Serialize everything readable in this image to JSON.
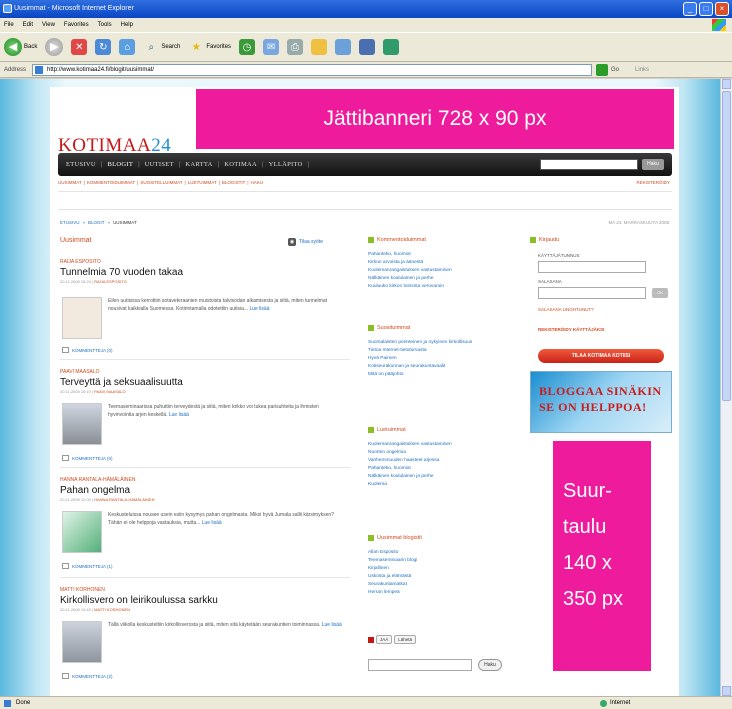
{
  "window": {
    "title": "Uusimmat - Microsoft Internet Explorer",
    "controls": [
      "_",
      "□",
      "×"
    ]
  },
  "menu": [
    "File",
    "Edit",
    "View",
    "Favorites",
    "Tools",
    "Help"
  ],
  "toolbar": {
    "back_label": "Back",
    "search_label": "Search",
    "favorites_label": "Favorites"
  },
  "address": {
    "label": "Address",
    "url": "http://www.kotimaa24.fi/blogit/uusimmat/",
    "go_label": "Go",
    "links_label": "Links"
  },
  "site": {
    "logo_main": "KOTIMAA",
    "logo_num": "24",
    "top_banner": "Jättibanneri 728 x 90 px",
    "nav": [
      "ETUSIVU",
      "BLOGIT",
      "UUTISET",
      "KARTTA",
      "KOTIMAA",
      "YLLÄPITO"
    ],
    "nav_search_btn": "Haku",
    "subnav": [
      "UUSIMMAT",
      "KOMMENTOIDUIMMAT",
      "SUOSITELLUIMMAT",
      "LUETUIMMAT",
      "BLOGISTIT",
      "HAKU"
    ],
    "subnav_register": "REKISTERÖIDY",
    "breadcrumb": [
      "ETUSIVU",
      "BLOGIT",
      "UUSIMMAT"
    ],
    "date": "MA 24. MARRASKUUTA 2008"
  },
  "left": {
    "section_title": "Uusimmat",
    "rss_label": "Tilaa syöte",
    "posts": [
      {
        "blogger": "RAIJA ESPOSITO",
        "title": "Tunnelmia 70 vuoden takaa",
        "meta": "20.11.2008 15:20",
        "author": "RAIJA ESPOSITO",
        "excerpt": "Eilen uutisissa kerrottiin sotaveteraanien muistoista talvisodan alkamisesta ja siitä, miten tunnelmat nousivat kaikkialla Suomessa. Kotirintamalla odotettiin uutisia...",
        "more": "Lue lisää",
        "comments": "KOMMENTTEJA (0)"
      },
      {
        "blogger": "PAAVI MAASALO",
        "title": "Terveyttä ja seksuaalisuutta",
        "meta": "20.11.2008 15:10",
        "author": "PAAVI MAASALO",
        "excerpt": "Teemaseminaarissa puhuttiin terveydestä ja siitä, miten kirkko voi tukea parisuhteita ja ihmisten hyvinvointia arjen keskellä.",
        "more": "Lue lisää",
        "comments": "KOMMENTTEJA (0)"
      },
      {
        "blogger": "HANNA RANTALA-HÄMÄLÄINEN",
        "title": "Pahan ongelma",
        "meta": "20.11.2008 12:00",
        "author": "HANNA RANTALA-HÄMÄLÄINEN",
        "excerpt": "Keskusteluissa nousee usein esiin kysymys pahan ongelmasta. Miksi hyvä Jumala sallii kärsimyksen? Tähän ei ole helppoja vastauksia, mutta...",
        "more": "Lue lisää",
        "comments": "KOMMENTTEJA (1)"
      },
      {
        "blogger": "MATTI KORHONEN",
        "title": "Kirkollisvero on leirikoulussa sarkku",
        "meta": "20.11.2008 10:45",
        "author": "MATTI KORHONEN",
        "excerpt": "Tällä viikolla keskusteltiin kirkollisverosta ja siitä, miten sitä käytetään seurakuntien toiminnassa.",
        "more": "Lue lisää",
        "comments": "KOMMENTTEJA (2)"
      }
    ]
  },
  "mid": {
    "blocks": [
      {
        "title": "Kommentoiduimmat",
        "items": [
          "Pahanteko, huomiot",
          "Kirkon arvoista ja äänestä",
          "Kuolemanrangaistuksen vastustaminen",
          "Nälkäinen koululainen ja perhe",
          "Kuuluuko kirkon toiminta verovaroin"
        ]
      },
      {
        "title": "Suosituimmat",
        "items": [
          "Suomalaisten perinteinen ja nykyinen kirkollisuus",
          "Tietoa Internet-tietoturvasta",
          "Hyvä Paimen",
          "Kotiseurakunnan ja seurakuntavaalit",
          "Mitä on pääjohto"
        ]
      },
      {
        "title": "Luetuimmat",
        "items": [
          "Kuolemanrangaistuksen vastustaminen",
          "Nuorten ongelmia",
          "Vanhemmuuden haasteet arjessa",
          "Pahanteko, huomiot",
          "Nälkäinen koululainen ja perhe",
          "Kuolema"
        ]
      },
      {
        "title": "Uusimmat blogistit",
        "items": [
          "Allan Esposito",
          "Teemaseminaarin blogi",
          "Kirjallinen",
          "Uskosta ja elämästä",
          "Seurakuntamatkat",
          "Herran lempeä"
        ]
      }
    ],
    "share": [
      "JAA",
      "Lähetä"
    ],
    "search_btn": "Haku"
  },
  "right": {
    "title": "Kirjaudu",
    "username_label": "KÄYTTÄJÄTUNNUS",
    "password_label": "SALASANA",
    "login_btn": "OK",
    "forgot": "SALASANA UNOHTUNUT?",
    "register": "REKISTERÖIDY KÄYTTÄJÄKSI",
    "order_btn": "TILAA KOTIMAA KOTIISI",
    "blog_ad_line1": "BLOGGAA SINÄKIN",
    "blog_ad_line2": "SE ON HELPPOA!",
    "skyscraper": [
      "Suur-",
      "taulu",
      "140 x",
      "350 px"
    ]
  },
  "status": {
    "done": "Done",
    "zone": "Internet"
  },
  "colors": {
    "banner_pink": "#ee1c9c",
    "accent_orange": "#d14a1d",
    "link_blue": "#1e6fc4",
    "nav_black": "#111111",
    "logo_blue": "#1e8fd6"
  },
  "icons": [
    "back-icon",
    "forward-icon",
    "stop-icon",
    "refresh-icon",
    "home-icon",
    "search-icon",
    "favorites-icon",
    "history-icon",
    "mail-icon",
    "print-icon",
    "rss-icon",
    "comment-icon"
  ]
}
